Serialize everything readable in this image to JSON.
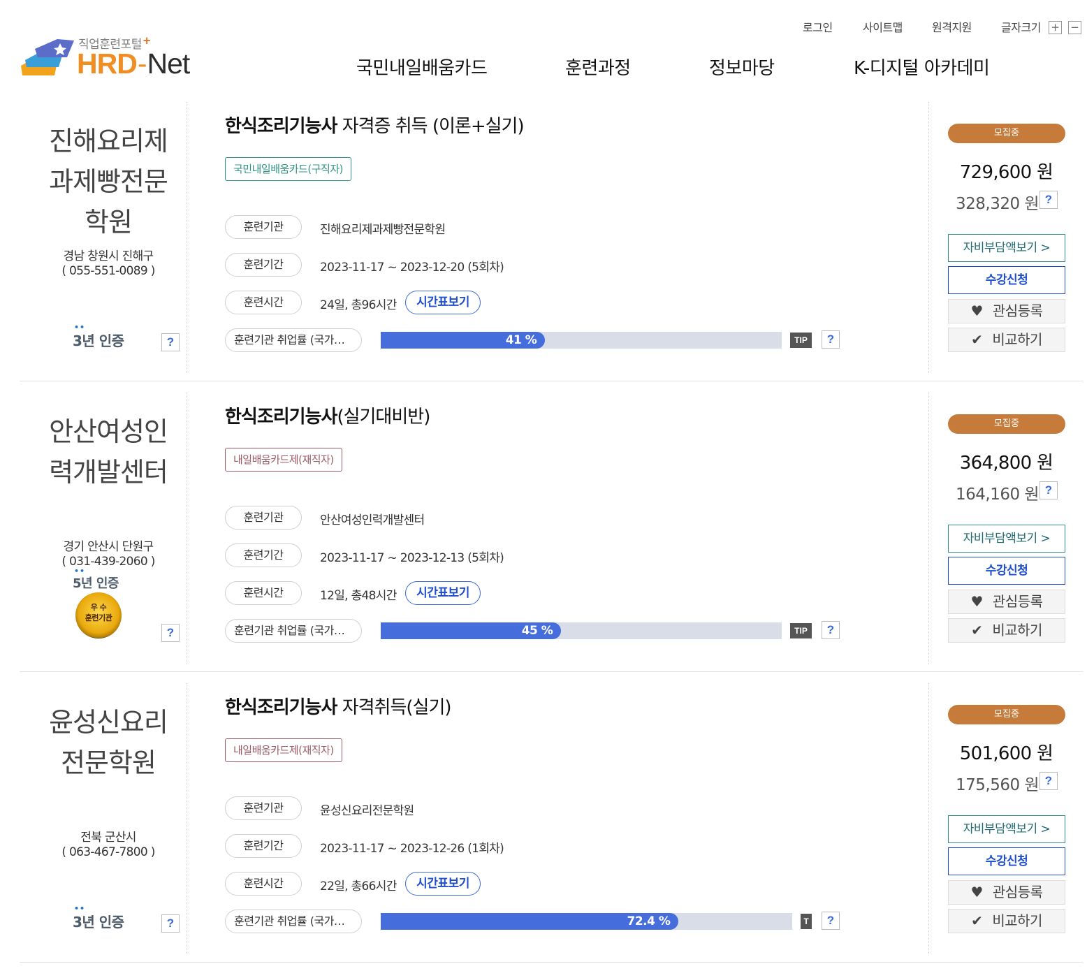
{
  "header": {
    "logo": {
      "tagline": "직업훈련포털",
      "plus": "+",
      "brand_hrd": "HRD",
      "brand_dash": "-",
      "brand_net": "Net"
    },
    "util_links": {
      "login": "로그인",
      "sitemap": "사이트맵",
      "remote": "원격지원",
      "font_size": "글자크기",
      "zoom_in": "+",
      "zoom_out": "−"
    },
    "nav": {
      "card": "국민내일배움카드",
      "courses": "훈련과정",
      "info": "정보마당",
      "kdigital": "K-디지털 아카데미"
    }
  },
  "labels": {
    "institution": "훈련기관",
    "period": "훈련기간",
    "hours": "훈련시간",
    "employment": "훈련기관 취업률 (국가…",
    "timetable": "시간표보기",
    "tip": "TIP",
    "help": "?",
    "status": "모집중",
    "self_pay": "자비부담액보기 >",
    "apply": "수강신청",
    "interest": "관심등록",
    "compare": "비교하기"
  },
  "courses": [
    {
      "org_name_lines": [
        "진해요리제",
        "과제빵전문",
        "학원"
      ],
      "address": "경남 창원시 진해구",
      "phone": "( 055-551-0089 )",
      "cert_num": "3",
      "cert_rest": "년 인증",
      "medal": null,
      "title_bold": "한식조리기능사",
      "title_rest": " 자격증 취득 (이론+실기)",
      "tag": "국민내일배움카드(구직자)",
      "tag_color": "#2f9585",
      "institution": "진해요리제과제빵전문학원",
      "period": "2023-11-17 ~ 2023-12-20 (5회차)",
      "hours": "24일, 총96시간",
      "employment_pct_label": "41 %",
      "employment_pct": 41,
      "tip": "TIP",
      "price": "729,600 원",
      "self_pay_price": "328,320 원"
    },
    {
      "org_name_lines": [
        "안산여성인",
        "력개발센터"
      ],
      "address": "경기 안산시 단원구",
      "phone": "( 031-439-2060 )",
      "cert_num": "5",
      "cert_rest": "년 인증",
      "medal": {
        "line1": "우 수",
        "line2": "훈련기관"
      },
      "title_bold": "한식조리기능사",
      "title_rest": "(실기대비반)",
      "tag": "내일배움카드제(재직자)",
      "tag_color": "#9c5a64",
      "institution": "안산여성인력개발센터",
      "period": "2023-11-17 ~ 2023-12-13 (5회차)",
      "hours": "12일, 총48시간",
      "employment_pct_label": "45 %",
      "employment_pct": 45,
      "tip": "TIP",
      "price": "364,800 원",
      "self_pay_price": "164,160 원"
    },
    {
      "org_name_lines": [
        "윤성신요리",
        "전문학원"
      ],
      "address": "전북 군산시",
      "phone": "( 063-467-7800 )",
      "cert_num": "3",
      "cert_rest": "년 인증",
      "medal": null,
      "title_bold": "한식조리기능사",
      "title_rest": " 자격취득(실기)",
      "tag": "내일배움카드제(재직자)",
      "tag_color": "#9c5a64",
      "institution": "윤성신요리전문학원",
      "period": "2023-11-17 ~ 2023-12-26 (1회차)",
      "hours": "22일, 총66시간",
      "employment_pct_label": "72.4 %",
      "employment_pct": 72.4,
      "tip": "T",
      "price": "501,600 원",
      "self_pay_price": "175,560 원"
    }
  ]
}
